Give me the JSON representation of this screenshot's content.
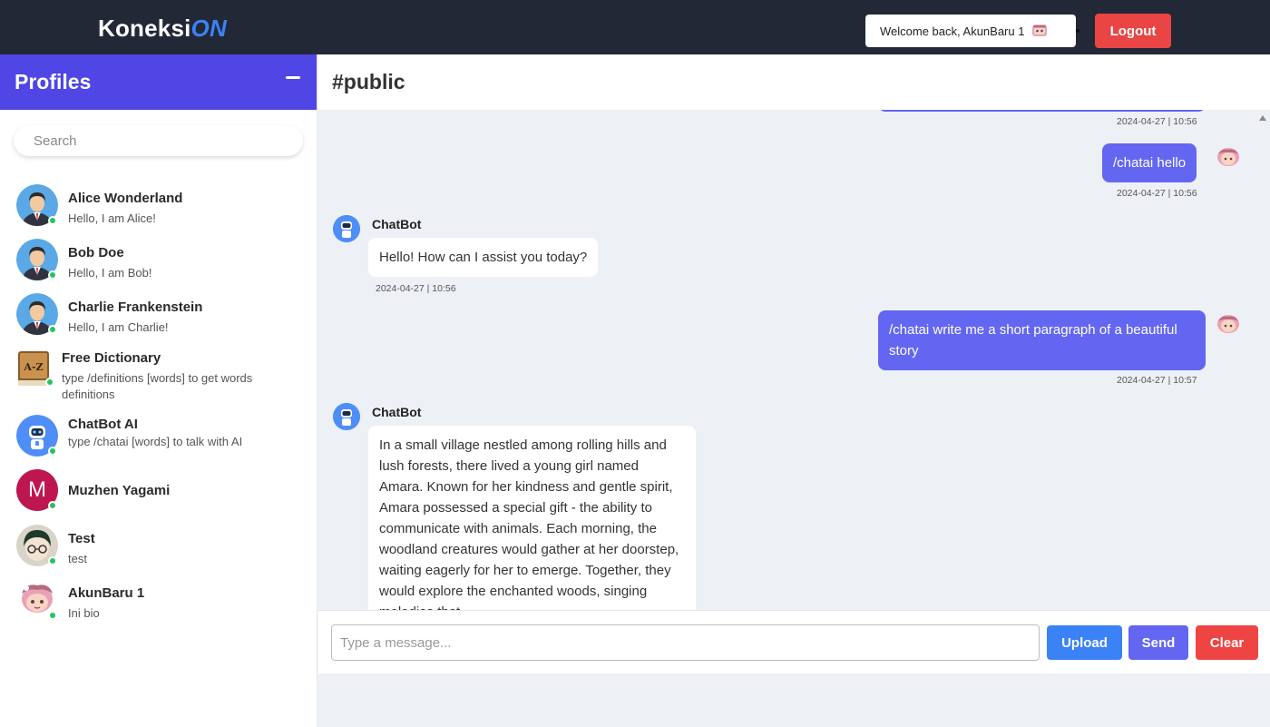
{
  "header": {
    "brand_prefix": "Koneksi",
    "brand_suffix": "ON",
    "welcome_text": "Welcome back, AkunBaru 1",
    "logout_label": "Logout"
  },
  "sidebar": {
    "title": "Profiles",
    "search_placeholder": "Search",
    "profiles": [
      {
        "name": "Alice Wonderland",
        "bio": "Hello, I am Alice!",
        "avatar": "person-avatar-icon",
        "online": true
      },
      {
        "name": "Bob Doe",
        "bio": "Hello, I am Bob!",
        "avatar": "person-avatar-icon",
        "online": true
      },
      {
        "name": "Charlie Frankenstein",
        "bio": "Hello, I am Charlie!",
        "avatar": "person-avatar-icon",
        "online": true
      },
      {
        "name": "Free Dictionary",
        "bio": "type /definitions [words] to get words definitions",
        "avatar": "dictionary-book-icon",
        "online": true
      },
      {
        "name": "ChatBot AI",
        "bio": "type /chatai [words] to talk with AI",
        "avatar": "robot-icon",
        "online": true
      },
      {
        "name": "Muzhen Yagami",
        "bio": "",
        "avatar": "letter-avatar",
        "initial": "M",
        "online": true
      },
      {
        "name": "Test",
        "bio": "test",
        "avatar": "anime-avatar-icon",
        "online": true
      },
      {
        "name": "AkunBaru 1",
        "bio": "Ini bio",
        "avatar": "pink-character-icon",
        "online": true
      }
    ]
  },
  "chat": {
    "channel": "#public",
    "messages": [
      {
        "from": "me",
        "text": "",
        "time": "2024-04-27 | 10:56"
      },
      {
        "from": "me",
        "text": "/chatai hello",
        "time": "2024-04-27 | 10:56"
      },
      {
        "from": "bot",
        "sender": "ChatBot",
        "text": "Hello! How can I assist you today?",
        "time": "2024-04-27 | 10:56"
      },
      {
        "from": "me",
        "text": "/chatai write me a short paragraph of a beautiful story",
        "time": "2024-04-27 | 10:57"
      },
      {
        "from": "bot",
        "sender": "ChatBot",
        "text": "In a small village nestled among rolling hills and lush forests, there lived a young girl named Amara. Known for her kindness and gentle spirit, Amara possessed a special gift - the ability to communicate with animals. Each morning, the woodland creatures would gather at her doorstep, waiting eagerly for her to emerge. Together, they would explore the enchanted woods, singing melodies that",
        "time": ""
      }
    ]
  },
  "composer": {
    "placeholder": "Type a message...",
    "upload_label": "Upload",
    "send_label": "Send",
    "clear_label": "Clear"
  },
  "colors": {
    "topbar": "#222835",
    "accent": "#4f46e5",
    "my_bubble": "#6366f1",
    "logout": "#e94545",
    "upload": "#3b82f6",
    "online": "#22c55e"
  }
}
